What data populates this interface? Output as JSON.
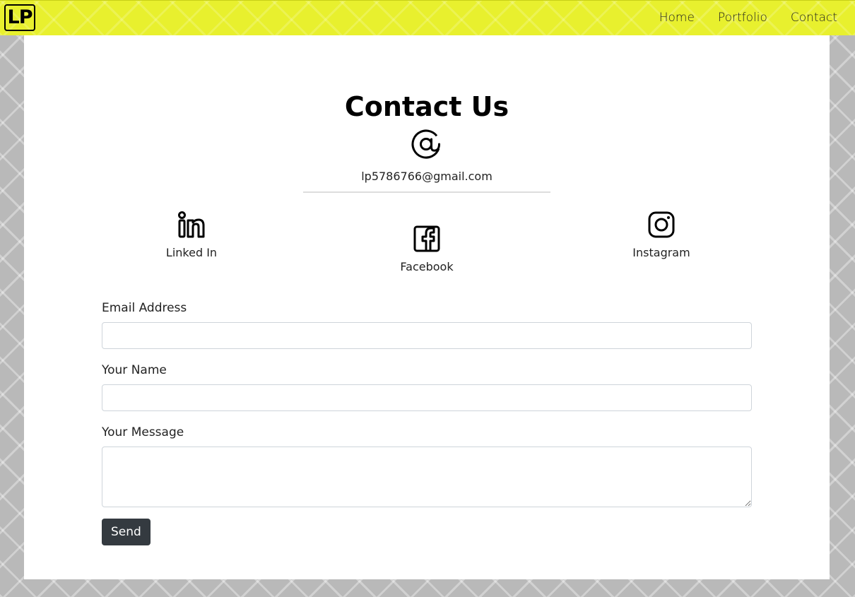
{
  "nav": {
    "logo": "LP",
    "links": [
      "Home",
      "Portfolio",
      "Contact"
    ]
  },
  "page": {
    "title": "Contact Us",
    "email": "lp5786766@gmail.com"
  },
  "social": {
    "linkedin": {
      "label": "Linked In",
      "icon": "linkedin-icon"
    },
    "facebook": {
      "label": "Facebook",
      "icon": "facebook-icon"
    },
    "instagram": {
      "label": "Instagram",
      "icon": "instagram-icon"
    }
  },
  "form": {
    "email_label": "Email Address",
    "email_value": "",
    "name_label": "Your Name",
    "name_value": "",
    "message_label": "Your Message",
    "message_value": "",
    "send_label": "Send"
  },
  "colors": {
    "navbar": "#e8f02e",
    "button": "#343a40",
    "background": "#b9b9b9"
  }
}
